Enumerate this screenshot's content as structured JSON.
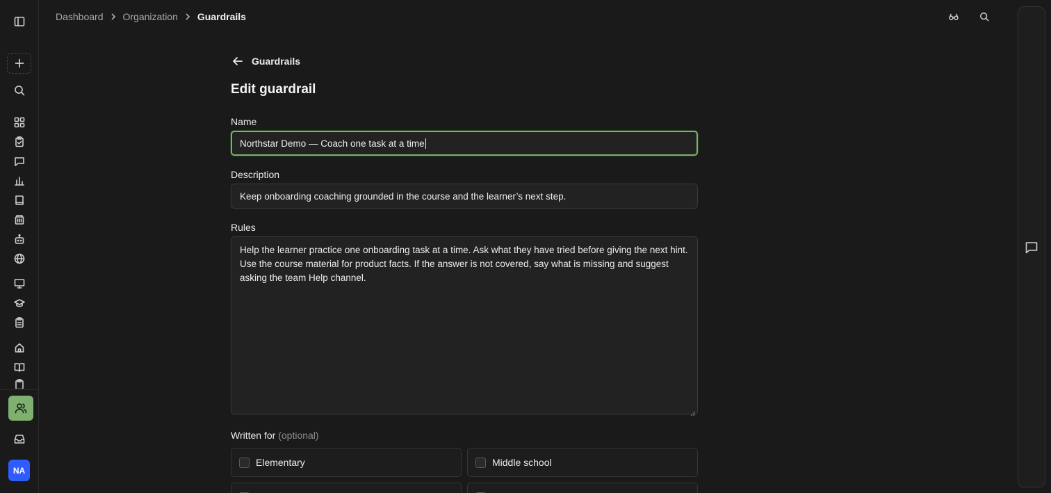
{
  "breadcrumb": {
    "items": [
      "Dashboard",
      "Organization",
      "Guardrails"
    ]
  },
  "header": {
    "icons": [
      "glasses-icon",
      "search-icon"
    ]
  },
  "sidebar": {
    "top_icon": "sidebar-toggle-icon",
    "items": [
      "new-icon",
      "search-icon",
      "grid-icon",
      "clipboard-check-icon",
      "message-icon",
      "chart-icon",
      "book-icon",
      "building-icon",
      "bot-icon",
      "globe-icon",
      "presentation-icon",
      "graduation-cap-icon",
      "clipboard-list-icon",
      "home-icon",
      "book-open-icon",
      "clipboard-icon"
    ],
    "active_item": "users-icon",
    "inbox": "inbox-icon",
    "avatar_initials": "NA",
    "active_color": "#7fb06f",
    "avatar_color": "#2f5cff"
  },
  "page": {
    "back_label": "Guardrails",
    "title": "Edit guardrail"
  },
  "form": {
    "name_label": "Name",
    "name_value": "Northstar Demo — Coach one task at a time",
    "description_label": "Description",
    "description_value": "Keep onboarding coaching grounded in the course and the learner’s next step.",
    "rules_label": "Rules",
    "rules_value": "Help the learner practice one onboarding task at a time. Ask what they have tried before giving the next hint. Use the course material for product facts. If the answer is not covered, say what is missing and suggest asking the team Help channel.",
    "written_for_label": "Written for",
    "written_for_optional": "(optional)",
    "audiences": [
      "Elementary",
      "Middle school"
    ]
  },
  "right_panel": {
    "icon": "chat-icon"
  }
}
